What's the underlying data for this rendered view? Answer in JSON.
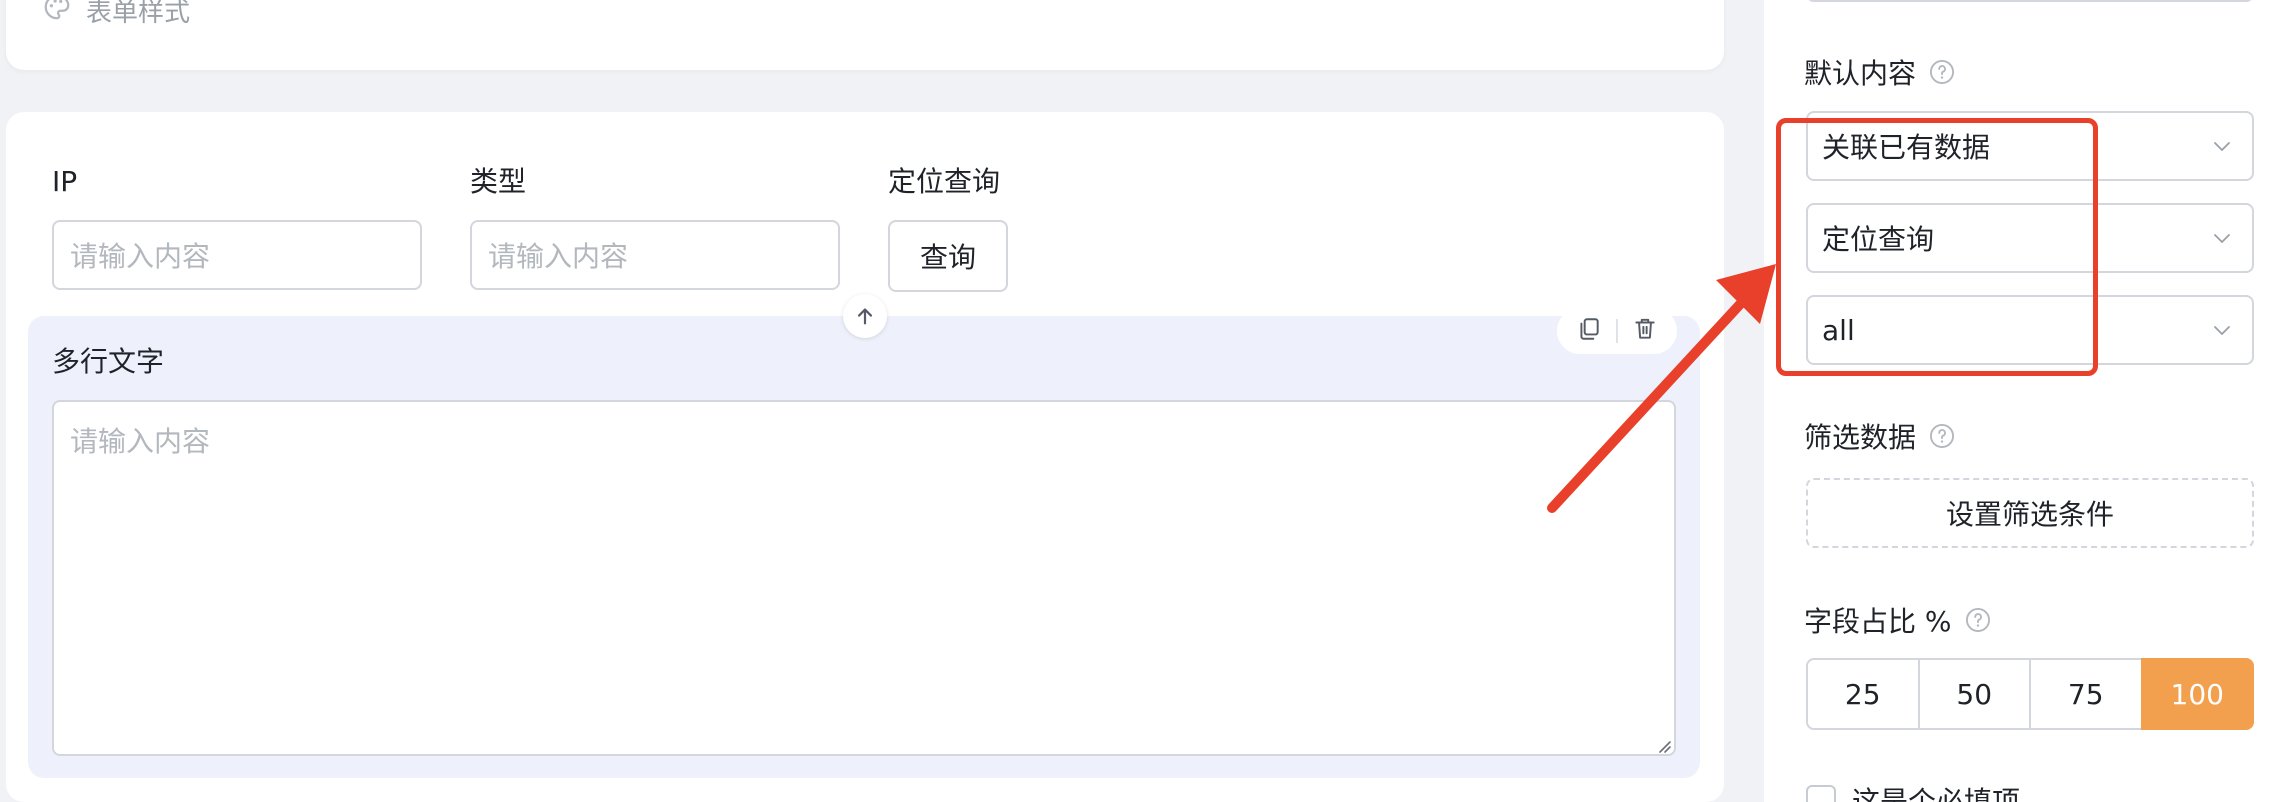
{
  "canvas": {
    "form_style_label": "表单样式",
    "fields": [
      {
        "label": "IP",
        "placeholder": "请输入内容"
      },
      {
        "label": "类型",
        "placeholder": "请输入内容"
      }
    ],
    "locate_field": {
      "label": "定位查询",
      "button_label": "查询"
    },
    "multiline": {
      "label": "多行文字",
      "placeholder": "请输入内容"
    }
  },
  "panel": {
    "default_content": {
      "title": "默认内容",
      "selects": [
        "关联已有数据",
        "定位查询",
        "all"
      ]
    },
    "filter": {
      "title": "筛选数据",
      "button_label": "设置筛选条件"
    },
    "ratio": {
      "title": "字段占比 %",
      "options": [
        "25",
        "50",
        "75",
        "100"
      ],
      "selected": "100"
    },
    "required": {
      "label": "这是个必填项"
    }
  },
  "colors": {
    "accent": "#f2a04e",
    "annotation": "#e8402a",
    "selected_block": "#eef1fb"
  }
}
